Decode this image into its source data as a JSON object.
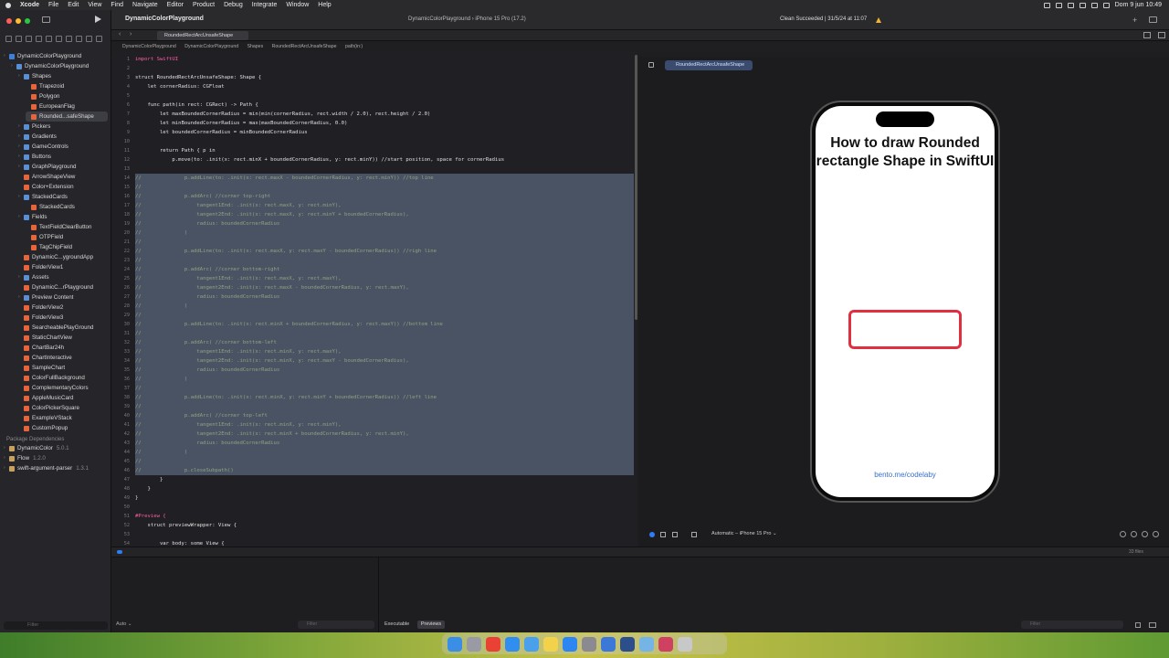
{
  "menubar": {
    "apple": "",
    "items": [
      "Xcode",
      "File",
      "Edit",
      "View",
      "Find",
      "Navigate",
      "Editor",
      "Product",
      "Debug",
      "Integrate",
      "Window",
      "Help"
    ],
    "clock": "Dom 9 jun  10:49"
  },
  "toolbar": {
    "scheme": "DynamicColorPlayground",
    "destination": "DynamicColorPlayground  ›  iPhone 15 Pro (17.2)",
    "status": "Clean Succeeded | 31/5/24 at 11:07"
  },
  "tab": {
    "label": "RoundedRectArcUnsafeShape"
  },
  "jumpbar": [
    "DynamicColorPlayground",
    "DynamicColorPlayground",
    "Shapes",
    "RoundedRectArcUnsafeShape",
    "path(in:)"
  ],
  "navigator": {
    "items": [
      {
        "label": "DynamicColorPlayground",
        "indent": 0,
        "kind": "proj"
      },
      {
        "label": "DynamicColorPlayground",
        "indent": 1,
        "kind": "folder"
      },
      {
        "label": "Shapes",
        "indent": 2,
        "kind": "folder"
      },
      {
        "label": "Trapezoid",
        "indent": 3,
        "kind": "swift"
      },
      {
        "label": "Polygon",
        "indent": 3,
        "kind": "swift"
      },
      {
        "label": "EuropeanFlag",
        "indent": 3,
        "kind": "swift"
      },
      {
        "label": "Rounded...safeShape",
        "indent": 3,
        "kind": "swift",
        "selected": true
      },
      {
        "label": "Pickers",
        "indent": 2,
        "kind": "folder"
      },
      {
        "label": "Gradients",
        "indent": 2,
        "kind": "folder"
      },
      {
        "label": "GameControls",
        "indent": 2,
        "kind": "folder"
      },
      {
        "label": "Buttons",
        "indent": 2,
        "kind": "folder"
      },
      {
        "label": "GraphPlayground",
        "indent": 2,
        "kind": "folder"
      },
      {
        "label": "ArrowShapeView",
        "indent": 2,
        "kind": "swift"
      },
      {
        "label": "Color+Extension",
        "indent": 2,
        "kind": "swift"
      },
      {
        "label": "StackedCards",
        "indent": 2,
        "kind": "folder"
      },
      {
        "label": "StackedCards",
        "indent": 3,
        "kind": "swift"
      },
      {
        "label": "Fields",
        "indent": 2,
        "kind": "folder"
      },
      {
        "label": "TextFieldClearButton",
        "indent": 3,
        "kind": "swift"
      },
      {
        "label": "OTPField",
        "indent": 3,
        "kind": "swift"
      },
      {
        "label": "TagChipField",
        "indent": 3,
        "kind": "swift"
      },
      {
        "label": "DynamicC...ygroundApp",
        "indent": 2,
        "kind": "swift"
      },
      {
        "label": "FolderView1",
        "indent": 2,
        "kind": "swift"
      },
      {
        "label": "Assets",
        "indent": 2,
        "kind": "folder"
      },
      {
        "label": "DynamicC...rPlayground",
        "indent": 2,
        "kind": "swift"
      },
      {
        "label": "Preview Content",
        "indent": 2,
        "kind": "folder"
      },
      {
        "label": "FolderView2",
        "indent": 2,
        "kind": "swift"
      },
      {
        "label": "FolderView3",
        "indent": 2,
        "kind": "swift"
      },
      {
        "label": "SearcheablePlayGround",
        "indent": 2,
        "kind": "swift"
      },
      {
        "label": "StaticChartView",
        "indent": 2,
        "kind": "swift"
      },
      {
        "label": "ChartBar24h",
        "indent": 2,
        "kind": "swift"
      },
      {
        "label": "ChartInteractive",
        "indent": 2,
        "kind": "swift"
      },
      {
        "label": "SampleChart",
        "indent": 2,
        "kind": "swift"
      },
      {
        "label": "ColorFullBackground",
        "indent": 2,
        "kind": "swift"
      },
      {
        "label": "ComplementaryColors",
        "indent": 2,
        "kind": "swift"
      },
      {
        "label": "AppleMusicCard",
        "indent": 2,
        "kind": "swift"
      },
      {
        "label": "ColorPickerSquare",
        "indent": 2,
        "kind": "swift"
      },
      {
        "label": "ExampleVStack",
        "indent": 2,
        "kind": "swift"
      },
      {
        "label": "CustomPopup",
        "indent": 2,
        "kind": "swift"
      }
    ],
    "package_header": "Package Dependencies",
    "packages": [
      {
        "label": "DynamicColor",
        "version": "5.0.1"
      },
      {
        "label": "Flow",
        "version": "1.2.0"
      },
      {
        "label": "swift-argument-parser",
        "version": "1.3.1"
      }
    ],
    "filter_placeholder": "Filter"
  },
  "code_lines": [
    {
      "n": "1",
      "t": "import SwiftUI"
    },
    {
      "n": "2",
      "t": ""
    },
    {
      "n": "3",
      "t": "struct RoundedRectArcUnsafeShape: Shape {"
    },
    {
      "n": "4",
      "t": "    let cornerRadius: CGFloat"
    },
    {
      "n": "5",
      "t": ""
    },
    {
      "n": "6",
      "t": "    func path(in rect: CGRect) -> Path {"
    },
    {
      "n": "7",
      "t": "        let maxBoundedCornerRadius = min(min(cornerRadius, rect.width / 2.0), rect.height / 2.0)"
    },
    {
      "n": "8",
      "t": "        let minBoundedCornerRadius = max(maxBoundedCornerRadius, 0.0)"
    },
    {
      "n": "9",
      "t": "        let boundedCornerRadius = minBoundedCornerRadius"
    },
    {
      "n": "10",
      "t": ""
    },
    {
      "n": "11",
      "t": "        return Path { p in"
    },
    {
      "n": "12",
      "t": "            p.move(to: .init(x: rect.minX + boundedCornerRadius, y: rect.minY)) //start position, space for cornerRadius"
    },
    {
      "n": "13",
      "t": ""
    },
    {
      "n": "14",
      "t": "//              p.addLine(to: .init(x: rect.maxX - boundedCornerRadius, y: rect.minY)) //top line"
    },
    {
      "n": "15",
      "t": "//"
    },
    {
      "n": "16",
      "t": "//              p.addArc( //corner top-right"
    },
    {
      "n": "17",
      "t": "//                  tangent1End: .init(x: rect.maxX, y: rect.minY),"
    },
    {
      "n": "18",
      "t": "//                  tangent2End: .init(x: rect.maxX, y: rect.minY + boundedCornerRadius),"
    },
    {
      "n": "19",
      "t": "//                  radius: boundedCornerRadius"
    },
    {
      "n": "20",
      "t": "//              )"
    },
    {
      "n": "21",
      "t": "//"
    },
    {
      "n": "22",
      "t": "//              p.addLine(to: .init(x: rect.maxX, y: rect.maxY - boundedCornerRadius)) //righ line"
    },
    {
      "n": "23",
      "t": "//"
    },
    {
      "n": "24",
      "t": "//              p.addArc( //corner bottom-right"
    },
    {
      "n": "25",
      "t": "//                  tangent1End: .init(x: rect.maxX, y: rect.maxY),"
    },
    {
      "n": "26",
      "t": "//                  tangent2End: .init(x: rect.maxX - boundedCornerRadius, y: rect.maxY),"
    },
    {
      "n": "27",
      "t": "//                  radius: boundedCornerRadius"
    },
    {
      "n": "28",
      "t": "//              )"
    },
    {
      "n": "29",
      "t": "//"
    },
    {
      "n": "30",
      "t": "//              p.addLine(to: .init(x: rect.minX + boundedCornerRadius, y: rect.maxY)) //bottom line"
    },
    {
      "n": "31",
      "t": "//"
    },
    {
      "n": "32",
      "t": "//              p.addArc( //corner bottom-left"
    },
    {
      "n": "33",
      "t": "//                  tangent1End: .init(x: rect.minX, y: rect.maxY),"
    },
    {
      "n": "34",
      "t": "//                  tangent2End: .init(x: rect.minX, y: rect.maxY - boundedCornerRadius),"
    },
    {
      "n": "35",
      "t": "//                  radius: boundedCornerRadius"
    },
    {
      "n": "36",
      "t": "//              )"
    },
    {
      "n": "37",
      "t": "//"
    },
    {
      "n": "38",
      "t": "//              p.addLine(to: .init(x: rect.minX, y: rect.minY + boundedCornerRadius)) //left line"
    },
    {
      "n": "39",
      "t": "//"
    },
    {
      "n": "40",
      "t": "//              p.addArc( //corner top-left"
    },
    {
      "n": "41",
      "t": "//                  tangent1End: .init(x: rect.minX, y: rect.minY),"
    },
    {
      "n": "42",
      "t": "//                  tangent2End: .init(x: rect.minX + boundedCornerRadius, y: rect.minY),"
    },
    {
      "n": "43",
      "t": "//                  radius: boundedCornerRadius"
    },
    {
      "n": "44",
      "t": "//              )"
    },
    {
      "n": "45",
      "t": "//"
    },
    {
      "n": "46",
      "t": "//              p.closeSubpath()"
    },
    {
      "n": "47",
      "t": "        }"
    },
    {
      "n": "48",
      "t": "    }"
    },
    {
      "n": "49",
      "t": "}"
    },
    {
      "n": "50",
      "t": ""
    },
    {
      "n": "51",
      "t": "#Preview {"
    },
    {
      "n": "52",
      "t": "    struct previewWrapper: View {"
    },
    {
      "n": "53",
      "t": ""
    },
    {
      "n": "54",
      "t": "        var body: some View {"
    }
  ],
  "canvas": {
    "chip": "RoundedRectArcUnsafeShape",
    "preview_title": "How to draw Rounded rectangle Shape in SwiftUI",
    "preview_link": "bento.me/codelaby",
    "device_picker": "Automatic – iPhone 15 Pro ⌄",
    "shape_stroke_color": "#e03040"
  },
  "debug": {
    "files": "33 files"
  },
  "console": {
    "auto": "Auto ⌄",
    "filter_placeholder": "Filter",
    "executable": "Executable",
    "previews": "Previews"
  },
  "dock": {
    "icons": [
      "finder-icon",
      "launchpad-icon",
      "chrome-icon",
      "safari-icon",
      "mail-icon",
      "notes-icon",
      "appstore-icon",
      "settings-icon",
      "xcode-icon",
      "instruments-icon",
      "preview-icon",
      "simulator-icon",
      "trash-icon"
    ],
    "icon_colors": [
      "#3a8ee6",
      "#9a9aa5",
      "#e94235",
      "#2f8ef0",
      "#4aa0ea",
      "#f2d24a",
      "#2e86f0",
      "#8a8a90",
      "#3b78d8",
      "#2c4f8c",
      "#76b4e6",
      "#d04060",
      "#c8c8c8"
    ]
  }
}
